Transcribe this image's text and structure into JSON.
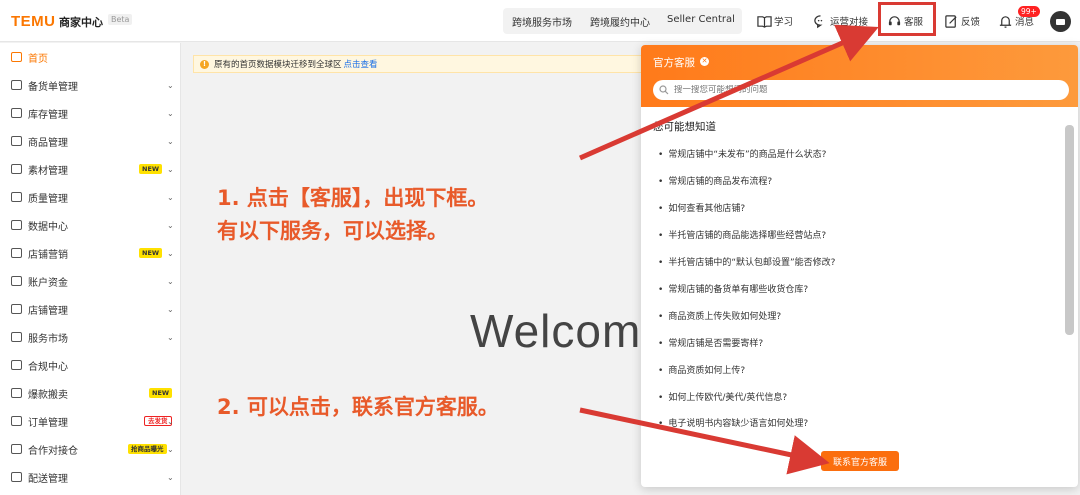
{
  "header": {
    "logo": "TEMU",
    "brand": "商家中心",
    "beta": "Beta",
    "nav": [
      "跨境服务市场",
      "跨境履约中心",
      "Seller Central"
    ],
    "tools": [
      {
        "label": "学习",
        "icon": "book-icon"
      },
      {
        "label": "运营对接",
        "icon": "chat-icon"
      },
      {
        "label": "客服",
        "icon": "headset-icon"
      },
      {
        "label": "反馈",
        "icon": "edit-icon"
      },
      {
        "label": "消息",
        "icon": "bell-icon"
      }
    ],
    "badge": "99+"
  },
  "sidebar": {
    "items": [
      {
        "label": "首页",
        "icon": "home-icon",
        "active": true
      },
      {
        "label": "备货单管理",
        "icon": "order-icon"
      },
      {
        "label": "库存管理",
        "icon": "warehouse-icon"
      },
      {
        "label": "商品管理",
        "icon": "goods-icon"
      },
      {
        "label": "素材管理",
        "icon": "material-icon",
        "tag": "NEW"
      },
      {
        "label": "质量管理",
        "icon": "shield-icon"
      },
      {
        "label": "数据中心",
        "icon": "data-icon"
      },
      {
        "label": "店铺营销",
        "icon": "marketing-icon",
        "tag": "NEW"
      },
      {
        "label": "账户资金",
        "icon": "wallet-icon"
      },
      {
        "label": "店铺管理",
        "icon": "store-icon"
      },
      {
        "label": "服务市场",
        "icon": "service-icon"
      },
      {
        "label": "合规中心",
        "icon": "compliance-icon"
      },
      {
        "label": "爆款搬卖",
        "icon": "hot-icon",
        "tag": "NEW"
      },
      {
        "label": "订单管理",
        "icon": "cart-icon",
        "tag": "去发货"
      },
      {
        "label": "合作对接仓",
        "icon": "partner-icon",
        "tag": "抢商品曝光"
      },
      {
        "label": "配送管理",
        "icon": "delivery-icon"
      }
    ]
  },
  "main": {
    "notice": "原有的首页数据模块迁移到全球区",
    "notice_link": "点击查看",
    "welcome": "Welcome",
    "annotation1_line1": "1. 点击【客服】，出现下框。",
    "annotation1_line2": "有以下服务，可以选择。",
    "annotation2": "2. 可以点击，联系官方客服。"
  },
  "panel": {
    "title": "官方客服",
    "close": "✕",
    "search_placeholder": "搜一搜您可能想问的问题",
    "subtitle": "您可能想知道",
    "questions": [
      "常规店铺中“未发布”的商品是什么状态?",
      "常规店铺的商品发布流程?",
      "如何查看其他店铺?",
      "半托管店铺的商品能选择哪些经营站点?",
      "半托管店铺中的“默认包邮设置”能否修改?",
      "常规店铺的备货单有哪些收货仓库?",
      "商品资质上传失败如何处理?",
      "常规店铺是否需要寄样?",
      "商品资质如何上传?",
      "如何上传欧代/美代/英代信息?",
      "电子说明书内容缺少语言如何处理?"
    ],
    "contact_button": "联系官方客服"
  },
  "colors": {
    "brand": "#fb7701",
    "annotation": "#e85a2a",
    "highlight": "#d93a33"
  }
}
